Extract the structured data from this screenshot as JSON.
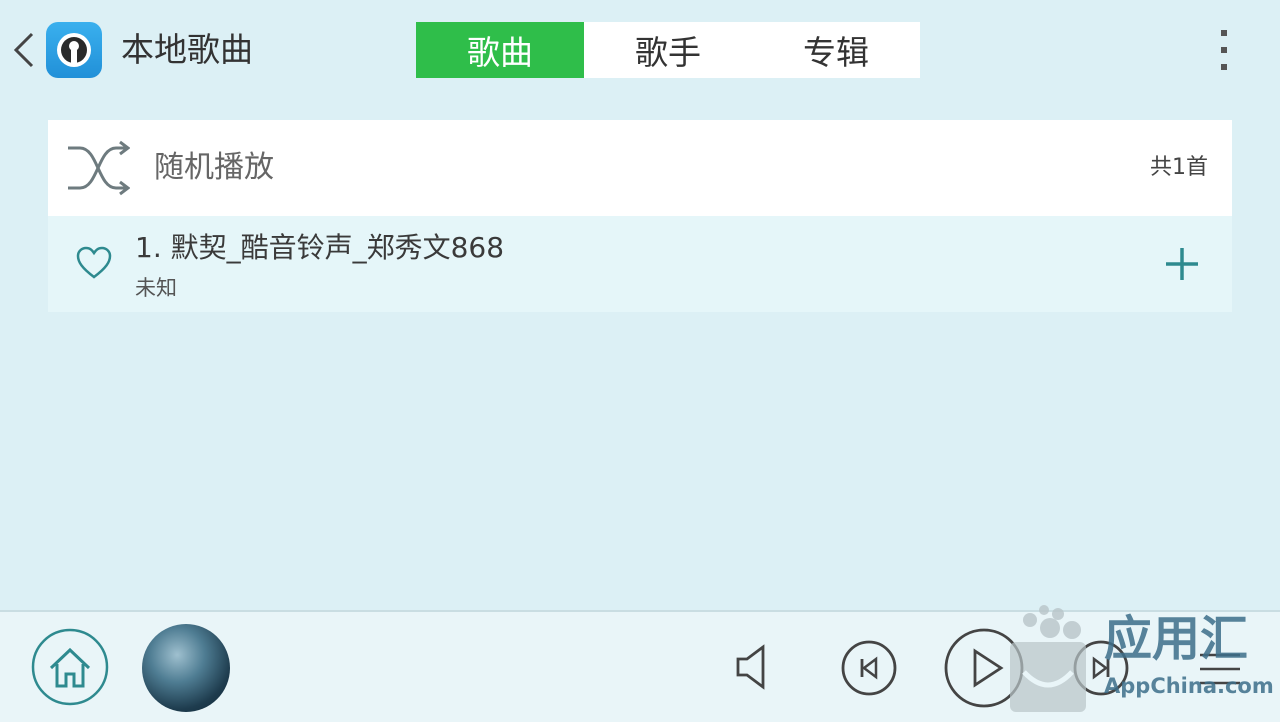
{
  "header": {
    "title": "本地歌曲",
    "tabs": [
      {
        "label": "歌曲",
        "active": true
      },
      {
        "label": "歌手",
        "active": false
      },
      {
        "label": "专辑",
        "active": false
      }
    ]
  },
  "shuffle": {
    "label": "随机播放",
    "count": "共1首"
  },
  "songs": [
    {
      "title": "1. 默契_酷音铃声_郑秀文868",
      "artist": "未知",
      "favorited": false
    }
  ],
  "watermark": {
    "text": "应用汇",
    "sub": "AppChina.com"
  },
  "colors": {
    "accent": "#2fbe4a",
    "background": "#dcf0f5",
    "icon": "#2e8a8f"
  },
  "icons": [
    "back-arrow-icon",
    "app-logo-icon",
    "more-vert-icon",
    "shuffle-icon",
    "heart-icon",
    "plus-icon",
    "home-icon",
    "volume-icon",
    "previous-icon",
    "play-icon",
    "next-icon",
    "playlist-icon"
  ]
}
